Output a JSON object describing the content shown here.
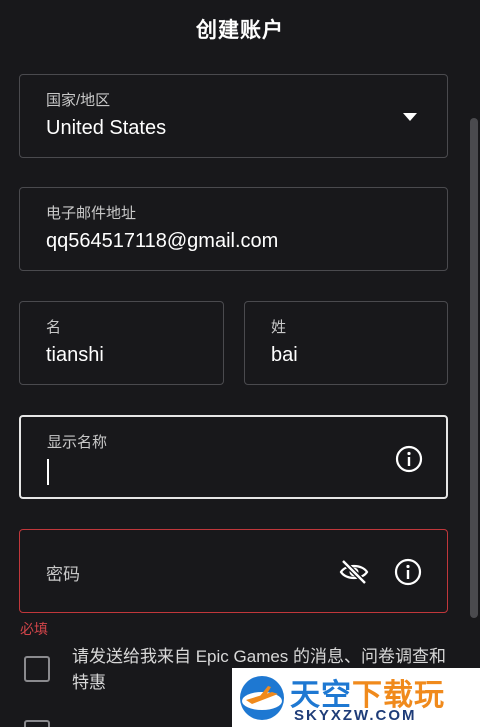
{
  "header": {
    "title": "创建账户"
  },
  "form": {
    "country": {
      "label": "国家/地区",
      "value": "United States"
    },
    "email": {
      "label": "电子邮件地址",
      "value": "qq564517118@gmail.com"
    },
    "first_name": {
      "label": "名",
      "value": "tianshi"
    },
    "last_name": {
      "label": "姓",
      "value": "bai"
    },
    "display_name": {
      "label": "显示名称",
      "value": ""
    },
    "password": {
      "label": "密码",
      "value": ""
    },
    "required_msg": "必填",
    "consent_label": "请发送给我来自 Epic Games 的消息、问卷调查和特惠"
  },
  "icons": {
    "dropdown": "chevron-down-icon",
    "info": "info-icon",
    "hide_password": "eye-off-icon"
  },
  "colors": {
    "background": "#18181b",
    "error": "#c0373b",
    "border": "#4a4a4e"
  },
  "watermark": {
    "title_part1": "天空",
    "title_part2": "下载玩",
    "subtitle": "SKYXZW.COM"
  }
}
